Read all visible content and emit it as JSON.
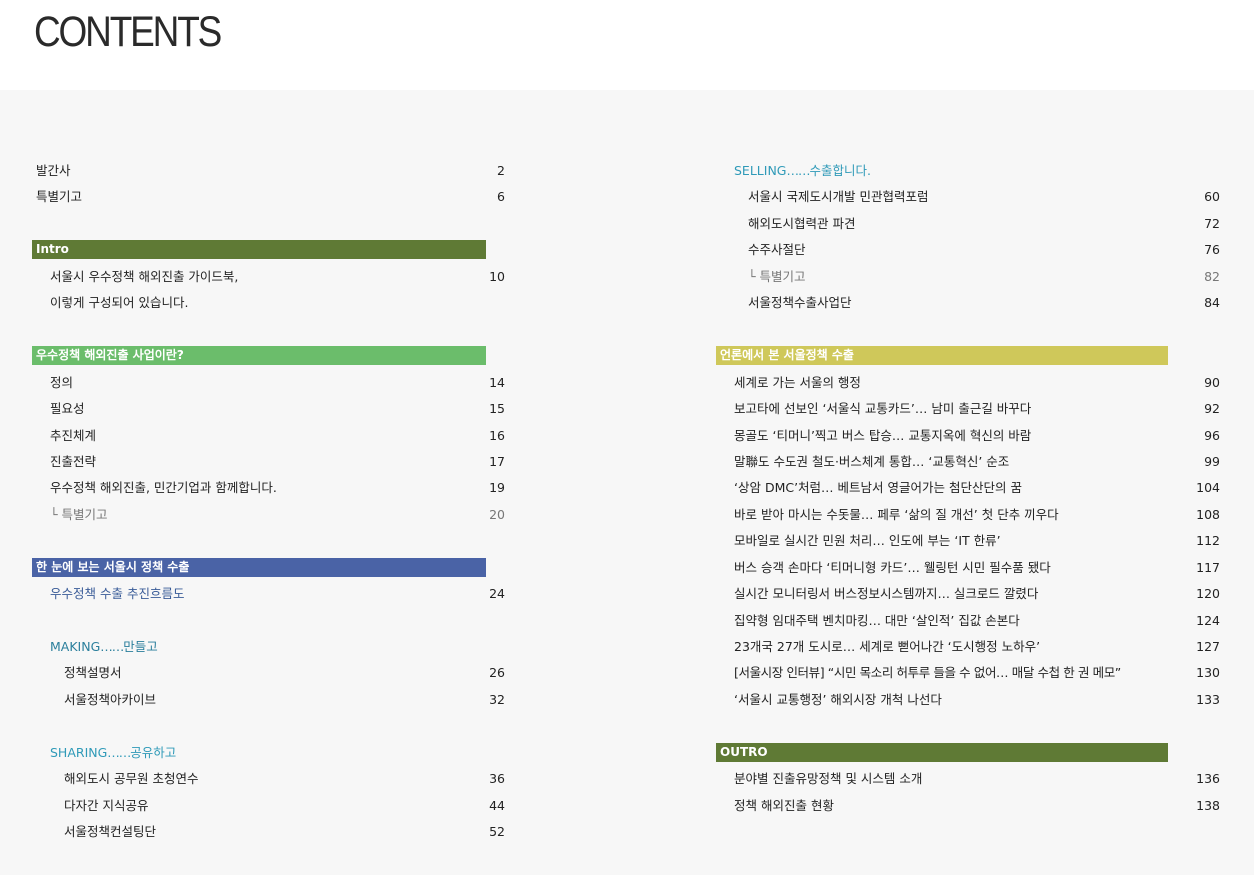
{
  "page_title": "CONTENTS",
  "colors": {
    "intro_bar": "#5f7a35",
    "green_bar": "#6bbd6b",
    "blue_bar": "#4a63a6",
    "yellow_bar": "#cfc85a",
    "outro_bar": "#5f7a35"
  },
  "left": {
    "publisher": {
      "label": "발간사",
      "page": "2"
    },
    "special": {
      "label": "특별기고",
      "page": "6"
    },
    "intro": {
      "heading": "Intro",
      "line1": "서울시 우수정책 해외진출 가이드북,",
      "line2": "이렇게 구성되어 있습니다.",
      "page": "10"
    },
    "what": {
      "heading": "우수정책 해외진출 사업이란?",
      "items": [
        {
          "label": "정의",
          "page": "14"
        },
        {
          "label": "필요성",
          "page": "15"
        },
        {
          "label": "추진체계",
          "page": "16"
        },
        {
          "label": "진출전략",
          "page": "17"
        },
        {
          "label": "우수정책 해외진출, 민간기업과 함께합니다.",
          "page": "19"
        },
        {
          "label": "└ 특별기고",
          "page": "20"
        }
      ]
    },
    "overview": {
      "heading": "한 눈에 보는 서울시 정책 수출",
      "flow": {
        "label": "우수정책 수출 추진흐름도",
        "page": "24"
      },
      "making": {
        "en": "MAKING",
        "dots": "……",
        "ko": "만들고",
        "items": [
          {
            "label": "정책설명서",
            "page": "26"
          },
          {
            "label": "서울정책아카이브",
            "page": "32"
          }
        ]
      },
      "sharing": {
        "en": "SHARING",
        "dots": "……",
        "ko": "공유하고",
        "items": [
          {
            "label": "해외도시 공무원 초청연수",
            "page": "36"
          },
          {
            "label": "다자간 지식공유",
            "page": "44"
          },
          {
            "label": "서울정책컨설팅단",
            "page": "52"
          }
        ]
      }
    }
  },
  "right": {
    "selling": {
      "en": "SELLING",
      "dots": "……",
      "ko": "수출합니다.",
      "items": [
        {
          "label": "서울시 국제도시개발 민관협력포럼",
          "page": "60"
        },
        {
          "label": "해외도시협력관 파견",
          "page": "72"
        },
        {
          "label": "수주사절단",
          "page": "76"
        },
        {
          "label": "└ 특별기고",
          "page": "82"
        },
        {
          "label": "서울정책수출사업단",
          "page": "84"
        }
      ]
    },
    "media": {
      "heading": "언론에서 본 서울정책 수출",
      "items": [
        {
          "label": "세계로 가는 서울의 행정",
          "page": "90"
        },
        {
          "label": "보고타에 선보인 ‘서울식 교통카드’… 남미 출근길 바꾸다",
          "page": "92"
        },
        {
          "label": "몽골도 ‘티머니’찍고 버스 탑승… 교통지옥에 혁신의 바람",
          "page": "96"
        },
        {
          "label": "말聯도 수도권 철도·버스체계 통합… ‘교통혁신’ 순조",
          "page": "99"
        },
        {
          "label": "‘상암 DMC’처럼… 베트남서 영글어가는 첨단산단의 꿈",
          "page": "104"
        },
        {
          "label": "바로 받아 마시는 수돗물… 페루 ‘삶의 질 개선’ 첫 단추 끼우다",
          "page": "108"
        },
        {
          "label": "모바일로 실시간 민원 처리… 인도에 부는 ‘IT 한류’",
          "page": "112"
        },
        {
          "label": "버스 승객 손마다 ‘티머니형 카드’… 웰링턴 시민 필수품 됐다",
          "page": "117"
        },
        {
          "label": "실시간 모니터링서 버스정보시스템까지… 실크로드 깔렸다",
          "page": "120"
        },
        {
          "label": "집약형 임대주택 벤치마킹… 대만 ‘살인적’ 집값 손본다",
          "page": "124"
        },
        {
          "label": "23개국 27개 도시로… 세계로 뻗어나간 ‘도시행정 노하우’",
          "page": "127"
        },
        {
          "label": "[서울시장 인터뷰] “시민 목소리 허투루 들을 수 없어… 매달 수첩 한 권 메모”",
          "page": "130"
        },
        {
          "label": "‘서울시 교통행정’ 해외시장 개척 나선다",
          "page": "133"
        }
      ]
    },
    "outro": {
      "heading": "OUTRO",
      "items": [
        {
          "label": "분야별 진출유망정책 및 시스템 소개",
          "page": "136"
        },
        {
          "label": "정책 해외진출 현황",
          "page": "138"
        }
      ]
    }
  }
}
